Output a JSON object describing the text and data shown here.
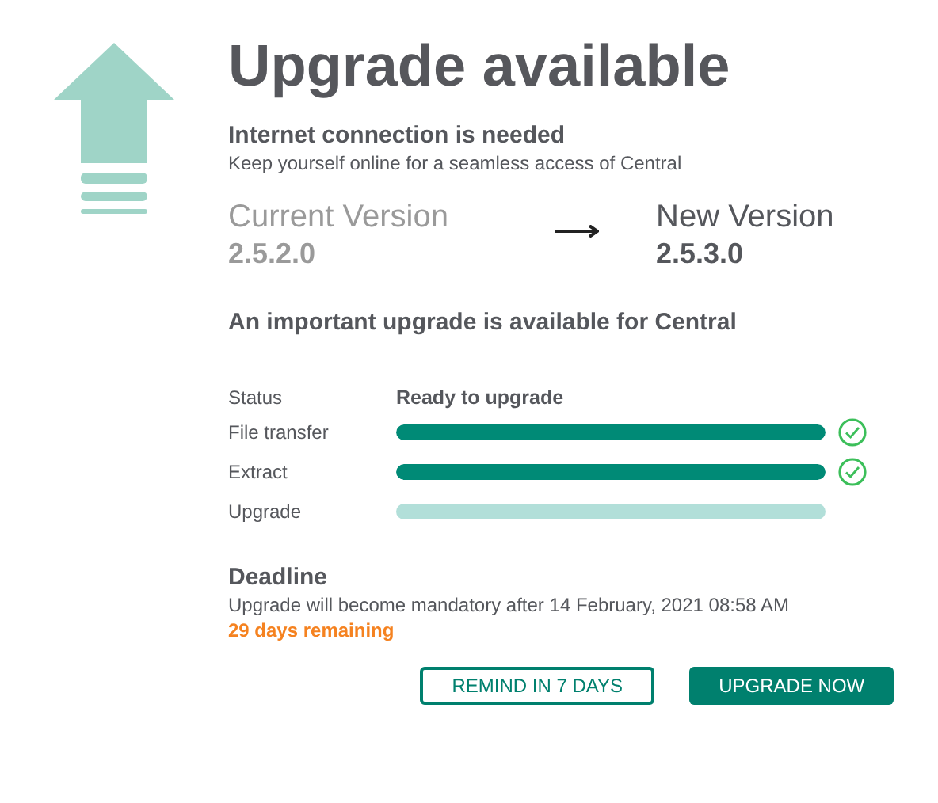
{
  "title": "Upgrade available",
  "connection": {
    "heading": "Internet connection is needed",
    "note": "Keep yourself online for a seamless access of Central"
  },
  "versions": {
    "current_label": "Current Version",
    "current": "2.5.2.0",
    "new_label": "New Version",
    "new": "2.5.3.0"
  },
  "message": "An important upgrade is available for Central",
  "status": {
    "label": "Status",
    "value": "Ready to upgrade"
  },
  "steps": [
    {
      "label": "File transfer",
      "level": 1,
      "done": true
    },
    {
      "label": "Extract",
      "level": 1,
      "done": true
    },
    {
      "label": "Upgrade",
      "level": 0,
      "done": false
    }
  ],
  "deadline": {
    "heading": "Deadline",
    "text": "Upgrade will become mandatory after 14 February, 2021 08:58 AM",
    "remaining": "29 days remaining"
  },
  "buttons": [
    {
      "label": "REMIND IN 7 DAYS",
      "kind": "outline"
    },
    {
      "label": "UPGRADE NOW",
      "kind": "primary"
    }
  ]
}
